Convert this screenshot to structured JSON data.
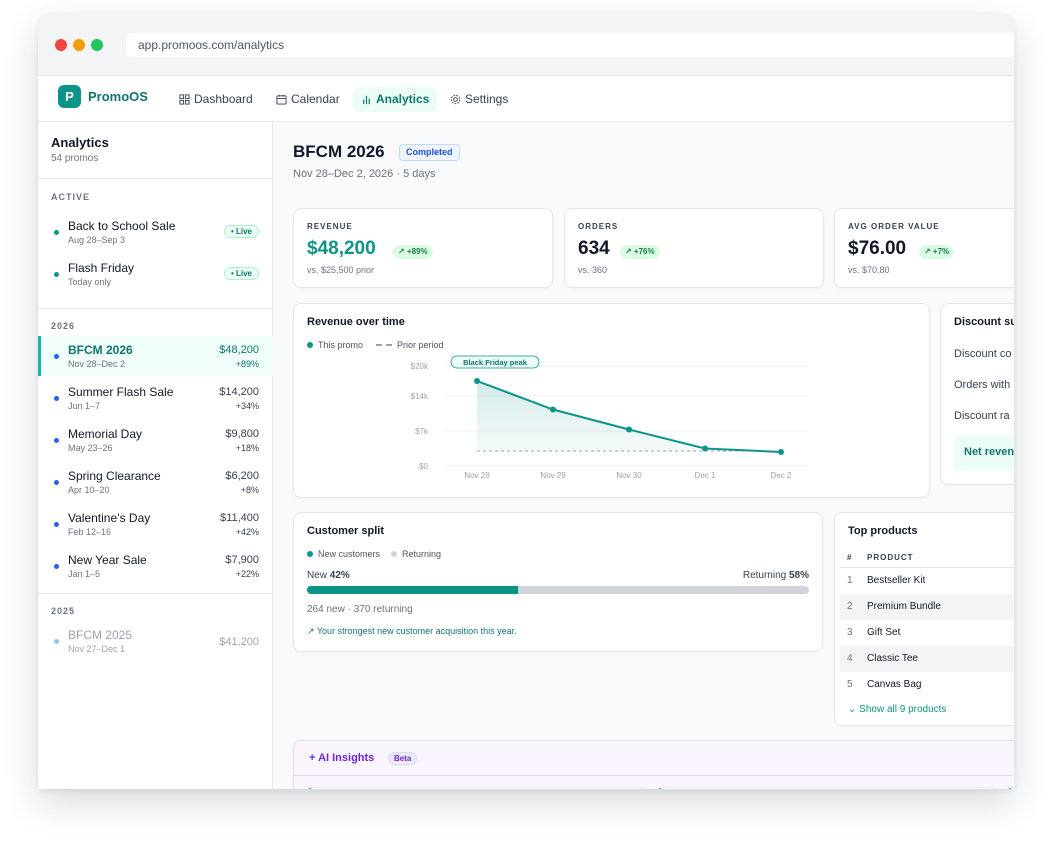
{
  "browser": {
    "url": "app.promoos.com/analytics"
  },
  "nav": {
    "logo_letter": "P",
    "brand": "PromoOS",
    "items": [
      {
        "label": "Dashboard",
        "icon": "grid-icon"
      },
      {
        "label": "Calendar",
        "icon": "calendar-icon"
      },
      {
        "label": "Analytics",
        "icon": "bar-chart-icon",
        "active": true
      },
      {
        "label": "Settings",
        "icon": "gear-icon"
      }
    ]
  },
  "sidebar": {
    "title": "Analytics",
    "subtitle": "54 promos",
    "groups": [
      {
        "label": "ACTIVE",
        "items": [
          {
            "name": "Back to School Sale",
            "date": "Aug 28–Sep 3",
            "badge": "• Live"
          },
          {
            "name": "Flash Friday",
            "date": "Today only",
            "badge": "• Live"
          }
        ]
      },
      {
        "label": "2026",
        "items": [
          {
            "name": "BFCM 2026",
            "date": "Nov 28–Dec 2",
            "amount": "$48,200",
            "change": "+89%",
            "selected": true
          },
          {
            "name": "Summer Flash Sale",
            "date": "Jun 1–7",
            "amount": "$14,200",
            "change": "+34%"
          },
          {
            "name": "Memorial Day",
            "date": "May 23–26",
            "amount": "$9,800",
            "change": "+18%"
          },
          {
            "name": "Spring Clearance",
            "date": "Apr 10–20",
            "amount": "$6,200",
            "change": "+8%"
          },
          {
            "name": "Valentine’s Day",
            "date": "Feb 12–16",
            "amount": "$11,400",
            "change": "+42%"
          },
          {
            "name": "New Year Sale",
            "date": "Jan 1–5",
            "amount": "$7,900",
            "change": "+22%"
          }
        ]
      },
      {
        "label": "2025",
        "items": [
          {
            "name": "BFCM 2025",
            "date": "Nov 27–Dec 1",
            "amount": "$41,200"
          }
        ]
      }
    ]
  },
  "promo": {
    "title": "BFCM 2026",
    "status": "Completed",
    "subtitle": "Nov 28–Dec 2, 2026 · 5 days"
  },
  "kpis": [
    {
      "label": "REVENUE",
      "value": "$48,200",
      "delta": "↗ +89%",
      "prior": "vs. $25,500 prior"
    },
    {
      "label": "ORDERS",
      "value": "634",
      "delta": "↗ +76%",
      "prior": "vs. 360"
    },
    {
      "label": "AVG ORDER VALUE",
      "value": "$76.00",
      "delta": "↗ +7%",
      "prior": "vs. $70.80"
    }
  ],
  "revenue_chart": {
    "title": "Revenue over time",
    "legend_this": "This promo",
    "legend_prior": "Prior period",
    "annotation": "Black Friday peak"
  },
  "chart_data": {
    "type": "area",
    "x": [
      "Nov 28",
      "Nov 29",
      "Nov 30",
      "Dec 1",
      "Dec 2"
    ],
    "series": [
      {
        "name": "This promo",
        "values": [
          17000,
          11300,
          7300,
          3500,
          2800
        ],
        "color": "#0d9488"
      },
      {
        "name": "Prior period",
        "values": [
          3000,
          3000,
          3000,
          3000,
          3000
        ],
        "color": "#9ca3af"
      }
    ],
    "y_ticks": [
      "$20k",
      "$14k",
      "$7k",
      "$0"
    ],
    "y_tick_values": [
      20000,
      14000,
      7000,
      0
    ],
    "ylim": [
      0,
      20000
    ],
    "grid": true,
    "legend": "top-left"
  },
  "discount": {
    "title": "Discount su",
    "rows": [
      "Discount co",
      "Orders with",
      "Discount ra"
    ],
    "net": "Net reven"
  },
  "split": {
    "title": "Customer split",
    "legend_new": "New customers",
    "legend_returning": "Returning",
    "new_label": "New",
    "new_pct": "42%",
    "returning_label": "Returning",
    "returning_pct": "58%",
    "new_fraction": 0.42,
    "counts": "264 new · 370 returning",
    "note": "↗ Your strongest new customer acquisition this year."
  },
  "top_products": {
    "title": "Top products",
    "col_num": "#",
    "col_product": "PRODUCT",
    "rows": [
      {
        "num": "1",
        "name": "Bestseller Kit"
      },
      {
        "num": "2",
        "name": "Premium Bundle"
      },
      {
        "num": "3",
        "name": "Gift Set"
      },
      {
        "num": "4",
        "name": "Classic Tee"
      },
      {
        "num": "5",
        "name": "Canvas Bag"
      }
    ],
    "show_all": "⌄ Show all 9 products"
  },
  "ai": {
    "title": "+ AI Insights",
    "beta": "Beta"
  },
  "colors": {
    "accent": "#0d9488",
    "accent_dark": "#0f766e",
    "purple": "#6d28d9"
  }
}
